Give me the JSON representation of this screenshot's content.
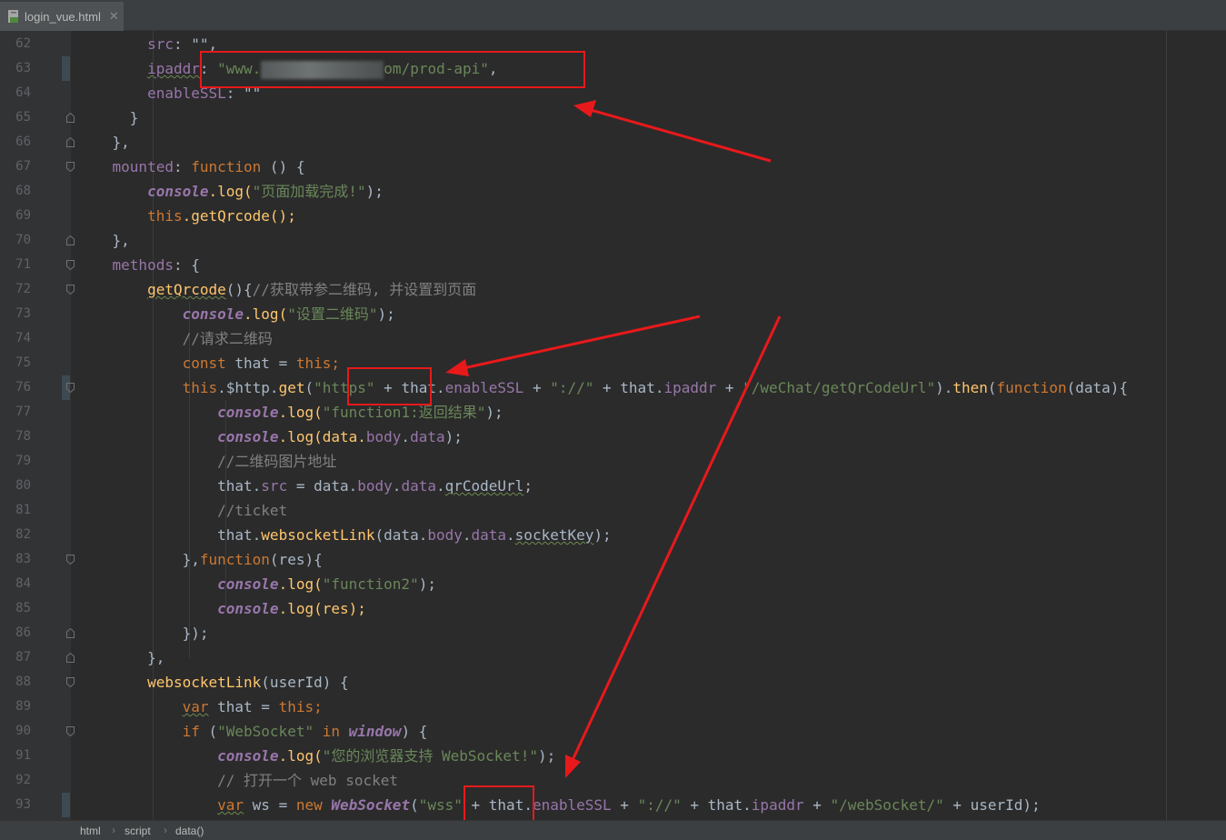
{
  "tab": {
    "filename": "login_vue.html",
    "close_glyph": "✕"
  },
  "lines": {
    "n62": "62",
    "n63": "63",
    "n64": "64",
    "n65": "65",
    "n66": "66",
    "n67": "67",
    "n68": "68",
    "n69": "69",
    "n70": "70",
    "n71": "71",
    "n72": "72",
    "n73": "73",
    "n74": "74",
    "n75": "75",
    "n76": "76",
    "n77": "77",
    "n78": "78",
    "n79": "79",
    "n80": "80",
    "n81": "81",
    "n82": "82",
    "n83": "83",
    "n84": "84",
    "n85": "85",
    "n86": "86",
    "n87": "87",
    "n88": "88",
    "n89": "89",
    "n90": "90",
    "n91": "91",
    "n92": "92",
    "n93": "93"
  },
  "code": {
    "l62_key": "src",
    "l62_rest": ": \"\",",
    "l63_key": "ipaddr",
    "l63_str_a": "\"www.",
    "l63_str_b": "om/prod-api\"",
    "l63_comma": ",",
    "l64_key": "enableSSL",
    "l64_rest": ": \"\"",
    "l65": "}",
    "l66": "},",
    "l67_key": "mounted",
    "l67_colon": ": ",
    "l67_kw": "function",
    "l67_rest": " () {",
    "l68_obj": "console",
    "l68_fn": ".log(",
    "l68_str": "\"页面加载完成!\"",
    "l68_end": ");",
    "l69_kw": "this",
    "l69_rest": ".getQrcode();",
    "l70": "},",
    "l71_key": "methods",
    "l71_rest": ": {",
    "l72_fn": "getQrcode",
    "l72_paren": "(){",
    "l72_cmt": "//获取带参二维码, 并设置到页面",
    "l73_obj": "console",
    "l73_fn": ".log(",
    "l73_str": "\"设置二维码\"",
    "l73_end": ");",
    "l74_cmt": "//请求二维码",
    "l75_kw": "const",
    "l75_rest": " that = ",
    "l75_this": "this",
    "l75_semi": ";",
    "l76_this": "this",
    "l76_a": ".$http.",
    "l76_get": "get",
    "l76_b": "(",
    "l76_https": "\"https\"",
    "l76_c": " + that.",
    "l76_ssl": "enableSSL",
    "l76_d": " + ",
    "l76_sep": "\"://\"",
    "l76_e": " + that.",
    "l76_ip": "ipaddr",
    "l76_f": " + ",
    "l76_path": "\"/weChat/getQrCodeUrl\"",
    "l76_g": ").",
    "l76_then": "then",
    "l76_h": "(",
    "l76_kwfn": "function",
    "l76_i": "(data){",
    "l77_obj": "console",
    "l77_fn": ".log(",
    "l77_str": "\"function1:返回结果\"",
    "l77_end": ");",
    "l78_obj": "console",
    "l78_fn": ".log(data.",
    "l78_body": "body",
    "l78_dot": ".",
    "l78_data": "data",
    "l78_end": ");",
    "l79_cmt": "//二维码图片地址",
    "l80_a": "that.",
    "l80_src": "src",
    "l80_b": " = data.",
    "l80_body": "body",
    "l80_dot": ".",
    "l80_data": "data",
    "l80_dot2": ".",
    "l80_qr": "qrCodeUrl",
    "l80_end": ";",
    "l81_cmt": "//ticket",
    "l82_a": "that.",
    "l82_fn": "websocketLink",
    "l82_b": "(data.",
    "l82_body": "body",
    "l82_dot": ".",
    "l82_data": "data",
    "l82_dot2": ".",
    "l82_key": "socketKey",
    "l82_end": ");",
    "l83_a": "},",
    "l83_kw": "function",
    "l83_b": "(res){",
    "l84_obj": "console",
    "l84_fn": ".log(",
    "l84_str": "\"function2\"",
    "l84_end": ");",
    "l85_obj": "console",
    "l85_fn": ".log(res);",
    "l86": "});",
    "l87": "},",
    "l88_fn": "websocketLink",
    "l88_rest": "(userId) {",
    "l89_kw": "var",
    "l89_rest": " that = ",
    "l89_this": "this",
    "l89_semi": ";",
    "l90_kw": "if",
    "l90_a": " (",
    "l90_str": "\"WebSocket\"",
    "l90_b": " ",
    "l90_in": "in",
    "l90_c": " ",
    "l90_win": "window",
    "l90_d": ") {",
    "l91_obj": "console",
    "l91_fn": ".log(",
    "l91_str": "\"您的浏览器支持 WebSocket!\"",
    "l91_end": ");",
    "l92_cmt": "// 打开一个 web socket",
    "l93_kw": "var",
    "l93_a": " ws = ",
    "l93_new": "new",
    "l93_b": " ",
    "l93_ws": "WebSocket",
    "l93_c": "(",
    "l93_wss": "\"wss\"",
    "l93_d": " + that.",
    "l93_ssl": "enableSSL",
    "l93_e": " + ",
    "l93_sep": "\"://\"",
    "l93_f": " + that.",
    "l93_ip": "ipaddr",
    "l93_g": " + ",
    "l93_path": "\"/webSocket/\"",
    "l93_h": " + userId);"
  },
  "statusbar": {
    "crumbs": [
      "html",
      "script",
      "data()"
    ],
    "sep": "›"
  },
  "colors": {
    "annotation": "#e8191b",
    "keyword": "#cc7832",
    "string": "#6a8759",
    "function": "#ffc66d",
    "property": "#9876aa",
    "comment": "#808080",
    "text": "#a9b7c6"
  }
}
